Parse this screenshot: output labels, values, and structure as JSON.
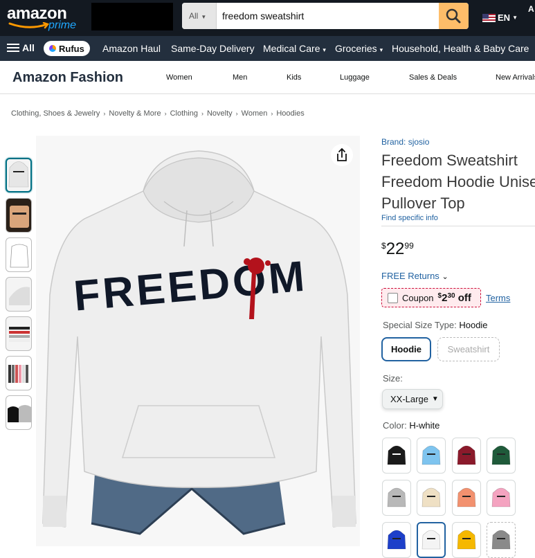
{
  "header": {
    "logo_word": "amazon",
    "logo_sub": "prime",
    "search_category": "All",
    "search_value": "freedom sweatshirt",
    "language": "EN",
    "account_initial": "A"
  },
  "nav": {
    "all_label": "All",
    "rufus_label": "Rufus",
    "items": [
      "Amazon Haul",
      "Same-Day Delivery",
      "Medical Care",
      "Groceries",
      "Household, Health & Baby Care"
    ]
  },
  "fashion": {
    "brand": "Amazon Fashion",
    "items": [
      "Women",
      "Men",
      "Kids",
      "Luggage",
      "Sales & Deals",
      "New Arrivals"
    ]
  },
  "breadcrumb": [
    "Clothing, Shoes & Jewelry",
    "Novelty & More",
    "Clothing",
    "Novelty",
    "Women",
    "Hoodies"
  ],
  "product": {
    "brand_link": "Brand: sjosio",
    "title": "Freedom Sweatshirt Freedom Hoodie Unisex Pullover Top",
    "find_info": "Find specific info",
    "price_symbol": "$",
    "price_whole": "22",
    "price_fraction": "99",
    "returns": "FREE Returns",
    "coupon_label": "Coupon",
    "coupon_amount_symbol": "$",
    "coupon_amount_whole": "2",
    "coupon_amount_fraction": "30",
    "coupon_off": "off",
    "terms": "Terms",
    "graphic_text": "FREEDOM"
  },
  "options": {
    "type_label": "Special Size Type:",
    "type_value": "Hoodie",
    "types": [
      "Hoodie",
      "Sweatshirt"
    ],
    "size_label": "Size:",
    "size_value": "XX-Large",
    "color_label": "Color:",
    "color_value": "H-white",
    "swatch_colors": [
      "#1a1a1a",
      "#7ec4ef",
      "#8b1a2b",
      "#1f5a3a",
      "#b8b8b8",
      "#efe0c4",
      "#f2916f",
      "#f4a3c0",
      "#1d3fc9",
      "#f4f4f4",
      "#f5b800",
      "#8a8a8a"
    ]
  },
  "colors": {
    "accent": "#2162a1",
    "nav_dark": "#131921",
    "nav_mid": "#232f3e",
    "search_button": "#febd69"
  }
}
